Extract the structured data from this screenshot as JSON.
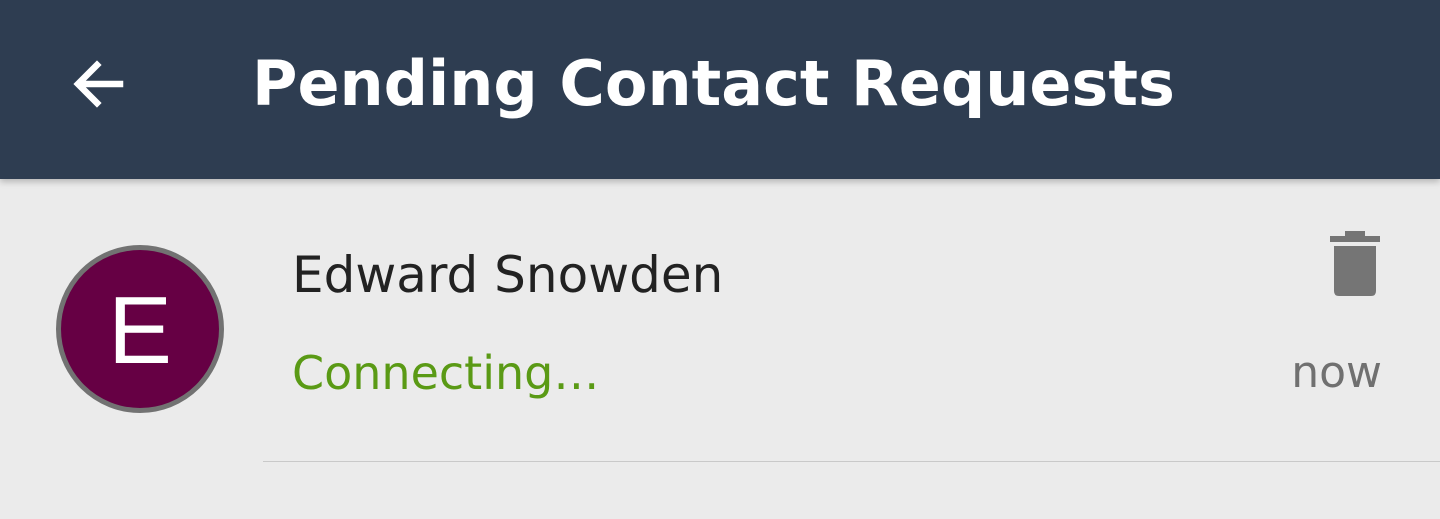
{
  "app_bar": {
    "title": "Pending Contact Requests",
    "back_icon": "arrow-back-icon",
    "background_color": "#2e3d51"
  },
  "requests": [
    {
      "avatar_letter": "E",
      "avatar_color": "#660044",
      "name": "Edward Snowden",
      "status": "Connecting…",
      "status_color": "#5a9a15",
      "time": "now",
      "delete_icon": "trash-icon"
    }
  ]
}
